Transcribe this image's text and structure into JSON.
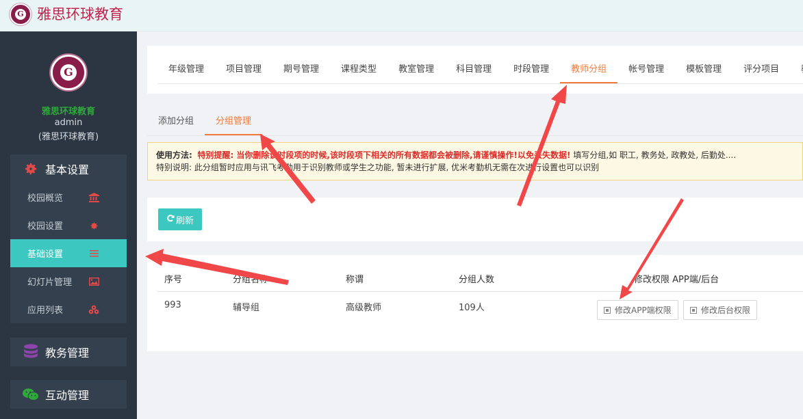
{
  "app": {
    "title": "雅思环球教育",
    "logo_letter": "G"
  },
  "sidebar": {
    "org_name": "雅思环球教育",
    "user": "admin",
    "user_org": "(雅思环球教育)",
    "groups": [
      {
        "label": "基本设置",
        "icon": "gear-icon",
        "items": [
          {
            "label": "校园概览",
            "icon": "bank-icon"
          },
          {
            "label": "校园设置",
            "icon": "cog-icon"
          },
          {
            "label": "基础设置",
            "icon": "list-icon",
            "active": true
          },
          {
            "label": "幻灯片管理",
            "icon": "image-icon"
          },
          {
            "label": "应用列表",
            "icon": "cubes-icon"
          }
        ]
      },
      {
        "label": "教务管理",
        "icon": "database-icon"
      },
      {
        "label": "互动管理",
        "icon": "wechat-icon"
      }
    ],
    "colors": {
      "active": "#3cc8c0",
      "bg": "#2b3642"
    }
  },
  "main_tabs": [
    "年级管理",
    "项目管理",
    "期号管理",
    "课程类型",
    "教室管理",
    "科目管理",
    "时段管理",
    "教师分组",
    "帐号管理",
    "模板管理",
    "评分项目",
    "教师"
  ],
  "main_tab_active": "教师分组",
  "sub_tabs": [
    "添加分组",
    "分组管理"
  ],
  "sub_tab_active": "分组管理",
  "notice": {
    "usage_label": "使用方法:",
    "warning": "特别提醒: 当你删除该时段项的时候,该时段项下相关的所有数据都会被删除,请谨慎操作!以免丢失数据!",
    "usage_text": "填写分组,如 职工, 教务处, 政教处, 后勤处....",
    "special": "特别说明: 此分组暂时应用与讯飞考勤用于识别教师或学生之功能, 暂未进行扩展, 优米考勤机无需在次进行设置也可以识别"
  },
  "toolbar": {
    "refresh_label": "刷新"
  },
  "table": {
    "headers": [
      "序号",
      "分组名称",
      "称谓",
      "分组人数",
      "修改权限 APP端/后台"
    ],
    "rows": [
      {
        "id": "993",
        "name": "辅导组",
        "title": "高级教师",
        "count": "109人",
        "app_btn": "修改APP端权限",
        "admin_btn": "修改后台权限"
      }
    ]
  },
  "accent": "#f07b3c"
}
